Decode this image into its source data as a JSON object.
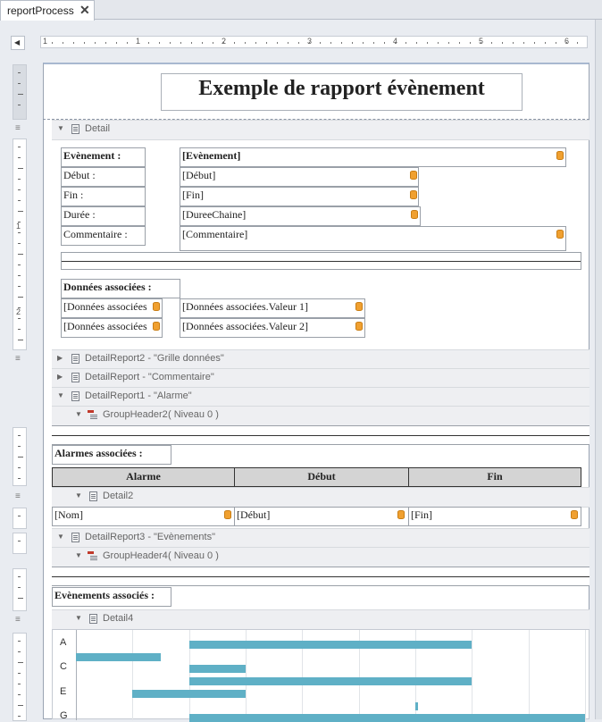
{
  "tab": {
    "title": "reportProcess",
    "close": "✕"
  },
  "ruler": {
    "numbers": [
      "1",
      "1",
      "2",
      "3",
      "4",
      "5",
      "6"
    ],
    "vnumbers": [
      "1",
      "2"
    ],
    "corner": "◀"
  },
  "report": {
    "title": "Exemple de rapport évènement",
    "bands": {
      "detail": "Detail",
      "detailreport2": "DetailReport2 - \"Grille données\"",
      "detailreportc": "DetailReport - \"Commentaire\"",
      "detailreport1": "DetailReport1 - \"Alarme\"",
      "groupheader2": "GroupHeader2",
      "groupheader2_level": "( Niveau 0 )",
      "detail2": "Detail2",
      "detailreport3": "DetailReport3 - \"Evènements\"",
      "groupheader4": "GroupHeader4",
      "groupheader4_level": "( Niveau 0 )",
      "detail4": "Detail4"
    },
    "fields": {
      "evenement_label": "Evènement :",
      "evenement_value": "[Evènement]",
      "debut_label": "Début :",
      "debut_value": "[Début]",
      "fin_label": "Fin :",
      "fin_value": "[Fin]",
      "duree_label": "Durée :",
      "duree_value": "[DureeChaine]",
      "commentaire_label": "Commentaire :",
      "commentaire_value": "[Commentaire]"
    },
    "donnees": {
      "title": "Données associées :",
      "rows": [
        {
          "name": "[Données associées",
          "value": "[Données associées.Valeur 1]"
        },
        {
          "name": "[Données associées",
          "value": "[Données associées.Valeur 2]"
        }
      ]
    },
    "alarmes": {
      "title": "Alarmes associées :",
      "headers": [
        "Alarme",
        "Début",
        "Fin"
      ],
      "row": [
        "[Nom]",
        "[Début]",
        "[Fin]"
      ]
    },
    "evenements": {
      "title": "Evènements associés :"
    }
  },
  "chart_data": {
    "type": "gantt",
    "categories": [
      "A",
      "C",
      "E",
      "G"
    ],
    "bars": [
      {
        "row": 0,
        "start": 2.0,
        "end": 7.0
      },
      {
        "row": 1,
        "start": 0.0,
        "end": 1.5
      },
      {
        "row": 2,
        "start": 2.0,
        "end": 3.0
      },
      {
        "row": 3,
        "start": 2.0,
        "end": 7.0
      },
      {
        "row": 4,
        "start": 1.0,
        "end": 3.0
      },
      {
        "row": 5,
        "start": 6.0,
        "end": 6.05
      },
      {
        "row": 6,
        "start": 2.0,
        "end": 9.0
      }
    ],
    "xlim": [
      0,
      9
    ],
    "grid": true
  }
}
